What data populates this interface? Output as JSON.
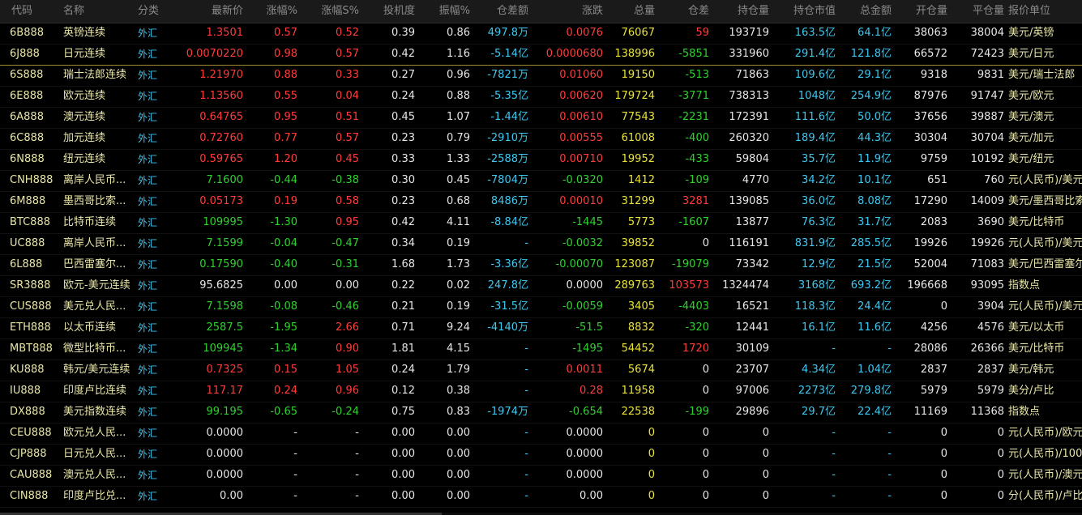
{
  "colors": {
    "up": "#ff3c3c",
    "down": "#2fd12f",
    "flat": "#e6e6e6",
    "volume": "#e8e23a",
    "amount": "#3ec7f0",
    "text": "#e8e5a8",
    "header": "#8a8a8a"
  },
  "columns": [
    "代码",
    "名称",
    "分类",
    "最新价",
    "涨幅%",
    "涨幅S%",
    "投机度",
    "振幅%",
    "仓差额",
    "涨跌",
    "总量",
    "仓差",
    "持仓量",
    "持仓市值",
    "总金额",
    "开仓量",
    "平仓量",
    "报价单位"
  ],
  "rows": [
    {
      "code": "6B888",
      "name": "英镑连续",
      "cat": "外汇",
      "price": "1.3501",
      "chg": "0.57",
      "chgs": "0.52",
      "spec": "0.39",
      "amp": "0.86",
      "oidiff": "497.8万",
      "updown": "0.0076",
      "vol": "76067",
      "posdiff": "59",
      "oi": "193719",
      "oival": "163.5亿",
      "amount": "64.1亿",
      "open": "38063",
      "close": "38004",
      "unit": "美元/英镑",
      "dir": "up",
      "posdir": "up"
    },
    {
      "code": "6J888",
      "name": "日元连续",
      "cat": "外汇",
      "price": "0.0070220",
      "chg": "0.98",
      "chgs": "0.57",
      "spec": "0.42",
      "amp": "1.16",
      "oidiff": "-5.14亿",
      "updown": "0.0000680",
      "vol": "138996",
      "posdiff": "-5851",
      "oi": "331960",
      "oival": "291.4亿",
      "amount": "121.8亿",
      "open": "66572",
      "close": "72423",
      "unit": "美元/日元",
      "dir": "up",
      "posdir": "down"
    },
    {
      "code": "6S888",
      "name": "瑞士法郎连续",
      "cat": "外汇",
      "price": "1.21970",
      "chg": "0.88",
      "chgs": "0.33",
      "spec": "0.27",
      "amp": "0.96",
      "oidiff": "-7821万",
      "updown": "0.01060",
      "vol": "19150",
      "posdiff": "-513",
      "oi": "71863",
      "oival": "109.6亿",
      "amount": "29.1亿",
      "open": "9318",
      "close": "9831",
      "unit": "美元/瑞士法郎",
      "dir": "up",
      "posdir": "down"
    },
    {
      "code": "6E888",
      "name": "欧元连续",
      "cat": "外汇",
      "price": "1.13560",
      "chg": "0.55",
      "chgs": "0.04",
      "spec": "0.24",
      "amp": "0.88",
      "oidiff": "-5.35亿",
      "updown": "0.00620",
      "vol": "179724",
      "posdiff": "-3771",
      "oi": "738313",
      "oival": "1048亿",
      "amount": "254.9亿",
      "open": "87976",
      "close": "91747",
      "unit": "美元/欧元",
      "dir": "up",
      "posdir": "down"
    },
    {
      "code": "6A888",
      "name": "澳元连续",
      "cat": "外汇",
      "price": "0.64765",
      "chg": "0.95",
      "chgs": "0.51",
      "spec": "0.45",
      "amp": "1.07",
      "oidiff": "-1.44亿",
      "updown": "0.00610",
      "vol": "77543",
      "posdiff": "-2231",
      "oi": "172391",
      "oival": "111.6亿",
      "amount": "50.0亿",
      "open": "37656",
      "close": "39887",
      "unit": "美元/澳元",
      "dir": "up",
      "posdir": "down"
    },
    {
      "code": "6C888",
      "name": "加元连续",
      "cat": "外汇",
      "price": "0.72760",
      "chg": "0.77",
      "chgs": "0.57",
      "spec": "0.23",
      "amp": "0.79",
      "oidiff": "-2910万",
      "updown": "0.00555",
      "vol": "61008",
      "posdiff": "-400",
      "oi": "260320",
      "oival": "189.4亿",
      "amount": "44.3亿",
      "open": "30304",
      "close": "30704",
      "unit": "美元/加元",
      "dir": "up",
      "posdir": "down"
    },
    {
      "code": "6N888",
      "name": "纽元连续",
      "cat": "外汇",
      "price": "0.59765",
      "chg": "1.20",
      "chgs": "0.45",
      "spec": "0.33",
      "amp": "1.33",
      "oidiff": "-2588万",
      "updown": "0.00710",
      "vol": "19952",
      "posdiff": "-433",
      "oi": "59804",
      "oival": "35.7亿",
      "amount": "11.9亿",
      "open": "9759",
      "close": "10192",
      "unit": "美元/纽元",
      "dir": "up",
      "posdir": "down"
    },
    {
      "code": "CNH888",
      "name": "离岸人民币...",
      "cat": "外汇",
      "price": "7.1600",
      "chg": "-0.44",
      "chgs": "-0.38",
      "spec": "0.30",
      "amp": "0.45",
      "oidiff": "-7804万",
      "updown": "-0.0320",
      "vol": "1412",
      "posdiff": "-109",
      "oi": "4770",
      "oival": "34.2亿",
      "amount": "10.1亿",
      "open": "651",
      "close": "760",
      "unit": "元(人民币)/美元",
      "dir": "down",
      "posdir": "down"
    },
    {
      "code": "6M888",
      "name": "墨西哥比索...",
      "cat": "外汇",
      "price": "0.05173",
      "chg": "0.19",
      "chgs": "0.58",
      "spec": "0.23",
      "amp": "0.68",
      "oidiff": "8486万",
      "updown": "0.00010",
      "vol": "31299",
      "posdiff": "3281",
      "oi": "139085",
      "oival": "36.0亿",
      "amount": "8.08亿",
      "open": "17290",
      "close": "14009",
      "unit": "美元/墨西哥比索",
      "dir": "up",
      "posdir": "up"
    },
    {
      "code": "BTC888",
      "name": "比特币连续",
      "cat": "外汇",
      "price": "109995",
      "chg": "-1.30",
      "chgs": "0.95",
      "spec": "0.42",
      "amp": "4.11",
      "oidiff": "-8.84亿",
      "updown": "-1445",
      "vol": "5773",
      "posdiff": "-1607",
      "oi": "13877",
      "oival": "76.3亿",
      "amount": "31.7亿",
      "open": "2083",
      "close": "3690",
      "unit": "美元/比特币",
      "dir": "down",
      "posdir": "down",
      "chgsdir": "up"
    },
    {
      "code": "UC888",
      "name": "离岸人民币...",
      "cat": "外汇",
      "price": "7.1599",
      "chg": "-0.04",
      "chgs": "-0.47",
      "spec": "0.34",
      "amp": "0.19",
      "oidiff": "-",
      "updown": "-0.0032",
      "vol": "39852",
      "posdiff": "0",
      "oi": "116191",
      "oival": "831.9亿",
      "amount": "285.5亿",
      "open": "19926",
      "close": "19926",
      "unit": "元(人民币)/美元",
      "dir": "down",
      "posdir": "flat"
    },
    {
      "code": "6L888",
      "name": "巴西雷塞尔...",
      "cat": "外汇",
      "price": "0.17590",
      "chg": "-0.40",
      "chgs": "-0.31",
      "spec": "1.68",
      "amp": "1.73",
      "oidiff": "-3.36亿",
      "updown": "-0.00070",
      "vol": "123087",
      "posdiff": "-19079",
      "oi": "73342",
      "oival": "12.9亿",
      "amount": "21.5亿",
      "open": "52004",
      "close": "71083",
      "unit": "美元/巴西雷塞尔",
      "dir": "down",
      "posdir": "down"
    },
    {
      "code": "SR3888",
      "name": "欧元-美元连续",
      "cat": "外汇",
      "price": "95.6825",
      "chg": "0.00",
      "chgs": "0.00",
      "spec": "0.22",
      "amp": "0.02",
      "oidiff": "247.8亿",
      "updown": "0.0000",
      "vol": "289763",
      "posdiff": "103573",
      "oi": "1324474",
      "oival": "3168亿",
      "amount": "693.2亿",
      "open": "196668",
      "close": "93095",
      "unit": "指数点",
      "dir": "flat",
      "posdir": "up"
    },
    {
      "code": "CUS888",
      "name": "美元兑人民...",
      "cat": "外汇",
      "price": "7.1598",
      "chg": "-0.08",
      "chgs": "-0.46",
      "spec": "0.21",
      "amp": "0.19",
      "oidiff": "-31.5亿",
      "updown": "-0.0059",
      "vol": "3405",
      "posdiff": "-4403",
      "oi": "16521",
      "oival": "118.3亿",
      "amount": "24.4亿",
      "open": "0",
      "close": "3904",
      "unit": "元(人民币)/美元",
      "dir": "down",
      "posdir": "down"
    },
    {
      "code": "ETH888",
      "name": "以太币连续",
      "cat": "外汇",
      "price": "2587.5",
      "chg": "-1.95",
      "chgs": "2.66",
      "spec": "0.71",
      "amp": "9.24",
      "oidiff": "-4140万",
      "updown": "-51.5",
      "vol": "8832",
      "posdiff": "-320",
      "oi": "12441",
      "oival": "16.1亿",
      "amount": "11.6亿",
      "open": "4256",
      "close": "4576",
      "unit": "美元/以太币",
      "dir": "down",
      "posdir": "down",
      "chgsdir": "up"
    },
    {
      "code": "MBT888",
      "name": "微型比特币...",
      "cat": "外汇",
      "price": "109945",
      "chg": "-1.34",
      "chgs": "0.90",
      "spec": "1.81",
      "amp": "4.15",
      "oidiff": "-",
      "updown": "-1495",
      "vol": "54452",
      "posdiff": "1720",
      "oi": "30109",
      "oival": "-",
      "amount": "-",
      "open": "28086",
      "close": "26366",
      "unit": "美元/比特币",
      "dir": "down",
      "posdir": "up",
      "chgsdir": "up"
    },
    {
      "code": "KU888",
      "name": "韩元/美元连续",
      "cat": "外汇",
      "price": "0.7325",
      "chg": "0.15",
      "chgs": "1.05",
      "spec": "0.24",
      "amp": "1.79",
      "oidiff": "-",
      "updown": "0.0011",
      "vol": "5674",
      "posdiff": "0",
      "oi": "23707",
      "oival": "4.34亿",
      "amount": "1.04亿",
      "open": "2837",
      "close": "2837",
      "unit": "美元/韩元",
      "dir": "up",
      "posdir": "flat"
    },
    {
      "code": "IU888",
      "name": "印度卢比连续",
      "cat": "外汇",
      "price": "117.17",
      "chg": "0.24",
      "chgs": "0.96",
      "spec": "0.12",
      "amp": "0.38",
      "oidiff": "-",
      "updown": "0.28",
      "vol": "11958",
      "posdiff": "0",
      "oi": "97006",
      "oival": "2273亿",
      "amount": "279.8亿",
      "open": "5979",
      "close": "5979",
      "unit": "美分/卢比",
      "dir": "up",
      "posdir": "flat"
    },
    {
      "code": "DX888",
      "name": "美元指数连续",
      "cat": "外汇",
      "price": "99.195",
      "chg": "-0.65",
      "chgs": "-0.24",
      "spec": "0.75",
      "amp": "0.83",
      "oidiff": "-1974万",
      "updown": "-0.654",
      "vol": "22538",
      "posdiff": "-199",
      "oi": "29896",
      "oival": "29.7亿",
      "amount": "22.4亿",
      "open": "11169",
      "close": "11368",
      "unit": "指数点",
      "dir": "down",
      "posdir": "down"
    },
    {
      "code": "CEU888",
      "name": "欧元兑人民...",
      "cat": "外汇",
      "price": "0.0000",
      "chg": "-",
      "chgs": "-",
      "spec": "0.00",
      "amp": "0.00",
      "oidiff": "-",
      "updown": "0.0000",
      "vol": "0",
      "posdiff": "0",
      "oi": "0",
      "oival": "-",
      "amount": "-",
      "open": "0",
      "close": "0",
      "unit": "元(人民币)/欧元",
      "dir": "flat",
      "posdir": "flat"
    },
    {
      "code": "CJP888",
      "name": "日元兑人民...",
      "cat": "外汇",
      "price": "0.0000",
      "chg": "-",
      "chgs": "-",
      "spec": "0.00",
      "amp": "0.00",
      "oidiff": "-",
      "updown": "0.0000",
      "vol": "0",
      "posdiff": "0",
      "oi": "0",
      "oival": "-",
      "amount": "-",
      "open": "0",
      "close": "0",
      "unit": "元(人民币)/100",
      "dir": "flat",
      "posdir": "flat"
    },
    {
      "code": "CAU888",
      "name": "澳元兑人民...",
      "cat": "外汇",
      "price": "0.0000",
      "chg": "-",
      "chgs": "-",
      "spec": "0.00",
      "amp": "0.00",
      "oidiff": "-",
      "updown": "0.0000",
      "vol": "0",
      "posdiff": "0",
      "oi": "0",
      "oival": "-",
      "amount": "-",
      "open": "0",
      "close": "0",
      "unit": "元(人民币)/澳元",
      "dir": "flat",
      "posdir": "flat"
    },
    {
      "code": "CIN888",
      "name": "印度卢比兑...",
      "cat": "外汇",
      "price": "0.00",
      "chg": "-",
      "chgs": "-",
      "spec": "0.00",
      "amp": "0.00",
      "oidiff": "-",
      "updown": "0.00",
      "vol": "0",
      "posdiff": "0",
      "oi": "0",
      "oival": "-",
      "amount": "-",
      "open": "0",
      "close": "0",
      "unit": "分(人民币)/卢比",
      "dir": "flat",
      "posdir": "flat"
    }
  ]
}
